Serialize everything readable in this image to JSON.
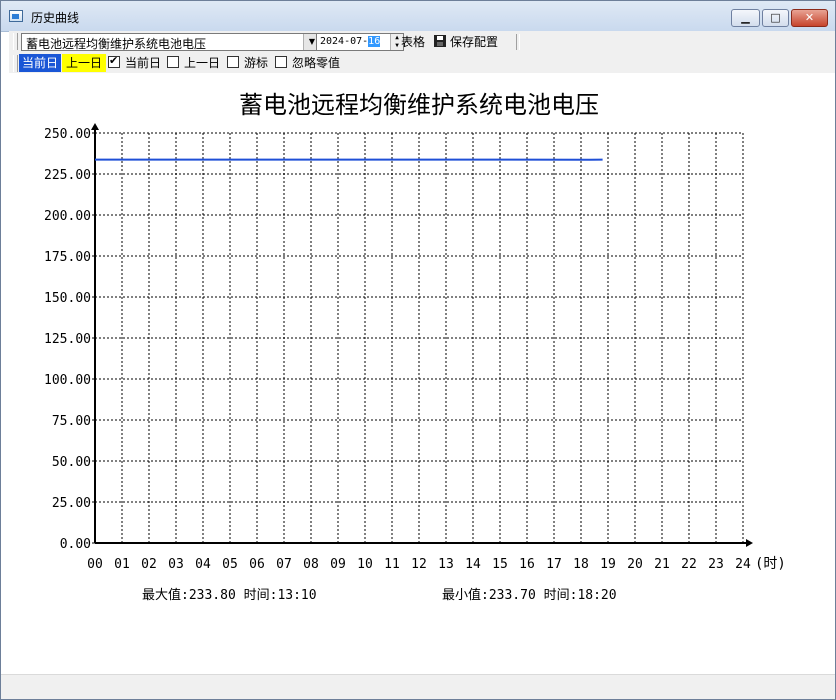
{
  "window": {
    "title": "历史曲线"
  },
  "toolbar": {
    "dataset_selected": "蓄电池远程均衡维护系统电池电压",
    "date_prefix": "2024-07-",
    "date_day": "16",
    "table_label": "表格",
    "save_label": "保存配置"
  },
  "day_bar": {
    "current_day_label": "当前日",
    "previous_day_label": "上一日",
    "checkboxes": [
      {
        "label": "当前日",
        "checked": true
      },
      {
        "label": "上一日",
        "checked": false
      },
      {
        "label": "游标",
        "checked": false
      },
      {
        "label": "忽略零值",
        "checked": false
      }
    ]
  },
  "chart_data": {
    "type": "line",
    "title": "蓄电池远程均衡维护系统电池电压",
    "xlabel": "(时)",
    "ylabel": "",
    "xlim": [
      0,
      24
    ],
    "ylim": [
      0,
      250
    ],
    "x_ticks": [
      "00",
      "01",
      "02",
      "03",
      "04",
      "05",
      "06",
      "07",
      "08",
      "09",
      "10",
      "11",
      "12",
      "13",
      "14",
      "15",
      "16",
      "17",
      "18",
      "19",
      "20",
      "21",
      "22",
      "23",
      "24"
    ],
    "y_ticks": [
      "0.00",
      "25.00",
      "50.00",
      "75.00",
      "100.00",
      "125.00",
      "150.00",
      "175.00",
      "200.00",
      "225.00",
      "250.00"
    ],
    "grid": true,
    "series": [
      {
        "color": "#1f4fd6",
        "x": [
          0,
          13.17,
          18.33,
          18.8
        ],
        "y": [
          233.75,
          233.8,
          233.7,
          233.75
        ]
      }
    ],
    "annotations": {
      "max_text": "最大值:233.80 时间:13:10",
      "min_text": "最小值:233.70 时间:18:20"
    }
  }
}
